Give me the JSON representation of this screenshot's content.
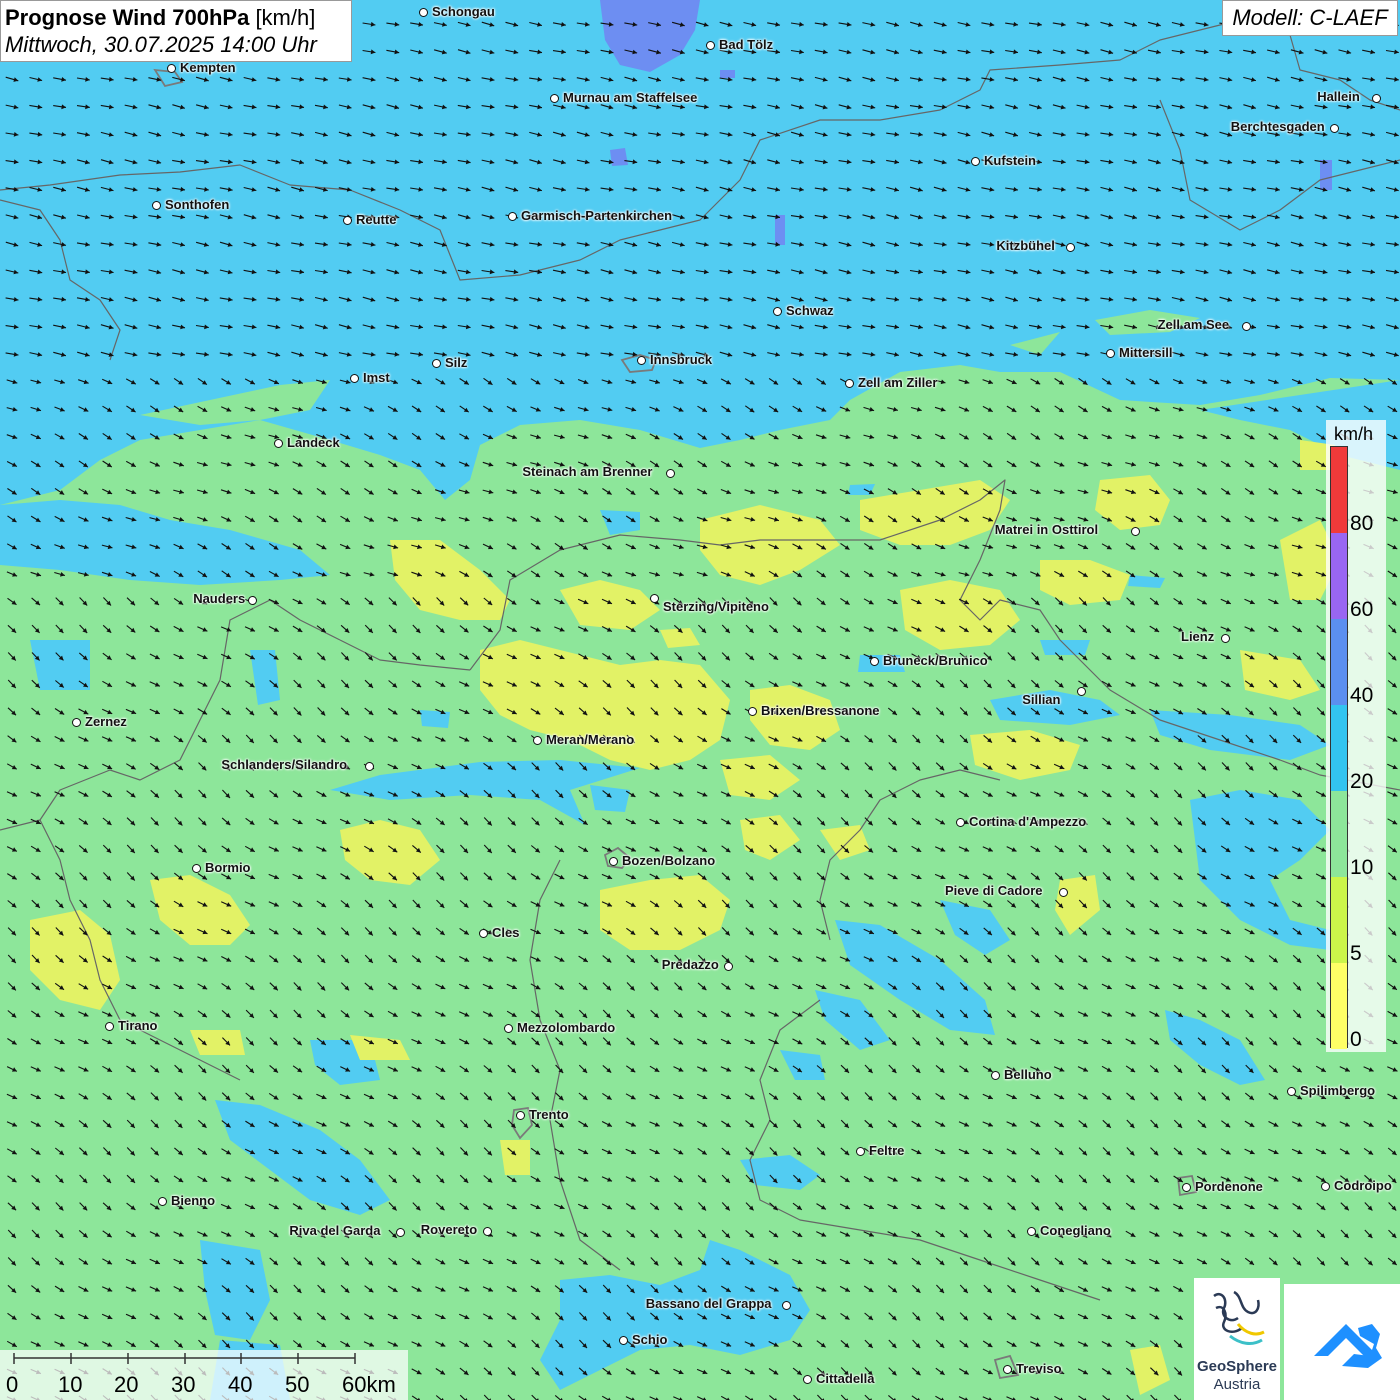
{
  "header": {
    "title_bold": "Prognose Wind 700hPa",
    "title_unit": "[km/h]",
    "datetime": "Mittwoch, 30.07.2025 14:00 Uhr",
    "model": "Modell: C-LAEF"
  },
  "legend": {
    "unit": "km/h",
    "segments": [
      {
        "from": 0,
        "to": 5,
        "color": "#ffff66"
      },
      {
        "from": 5,
        "to": 10,
        "color": "#ccf54a"
      },
      {
        "from": 10,
        "to": 20,
        "color": "#8de69a"
      },
      {
        "from": 20,
        "to": 40,
        "color": "#33c4f0"
      },
      {
        "from": 40,
        "to": 60,
        "color": "#5b8ff0"
      },
      {
        "from": 60,
        "to": 80,
        "color": "#9966f2"
      },
      {
        "from": 80,
        "to": 100,
        "color": "#f03a3a"
      }
    ],
    "labels": [
      "0",
      "5",
      "10",
      "20",
      "40",
      "60",
      "80"
    ]
  },
  "scale": {
    "labels": [
      "0",
      "10",
      "20",
      "30",
      "40",
      "50",
      "60km"
    ]
  },
  "logos": {
    "geosphere_name": "GeoSphere",
    "geosphere_country": "Austria",
    "app_icon": "weather-app-icon"
  },
  "colors": {
    "land_green": "#8de69a",
    "wind_blue": "#52ccf2",
    "wind_yellow": "#e2f266",
    "lake_blue": "#6d8ef2",
    "arrow": "#111111"
  },
  "cities": [
    {
      "name": "Schongau"
    },
    {
      "name": "Bad Tölz"
    },
    {
      "name": "Kempten"
    },
    {
      "name": "Murnau am Staffelsee"
    },
    {
      "name": "Hallein"
    },
    {
      "name": "Berchtesgaden"
    },
    {
      "name": "Kufstein"
    },
    {
      "name": "Sonthofen"
    },
    {
      "name": "Reutte"
    },
    {
      "name": "Garmisch-Partenkirchen"
    },
    {
      "name": "Kitzbühel"
    },
    {
      "name": "Schwaz"
    },
    {
      "name": "Zell am See"
    },
    {
      "name": "Mittersill"
    },
    {
      "name": "Innsbruck"
    },
    {
      "name": "Silz"
    },
    {
      "name": "Imst"
    },
    {
      "name": "Zell am Ziller"
    },
    {
      "name": "Landeck"
    },
    {
      "name": "Steinach am Brenner"
    },
    {
      "name": "Matrei in Osttirol"
    },
    {
      "name": "Nauders"
    },
    {
      "name": "Sterzing/Vipiteno"
    },
    {
      "name": "Lienz"
    },
    {
      "name": "Bruneck/Brunico"
    },
    {
      "name": "Sillian"
    },
    {
      "name": "Brixen/Bressanone"
    },
    {
      "name": "Zernez"
    },
    {
      "name": "Meran/Merano"
    },
    {
      "name": "Schlanders/Silandro"
    },
    {
      "name": "Cortina d'Ampezzo"
    },
    {
      "name": "Bozen/Bolzano"
    },
    {
      "name": "Bormio"
    },
    {
      "name": "Pieve di Cadore"
    },
    {
      "name": "Cles"
    },
    {
      "name": "Predazzo"
    },
    {
      "name": "Tirano"
    },
    {
      "name": "Mezzolombardo"
    },
    {
      "name": "Belluno"
    },
    {
      "name": "Spilimbergo"
    },
    {
      "name": "Trento"
    },
    {
      "name": "Feltre"
    },
    {
      "name": "Bienno"
    },
    {
      "name": "Pordenone"
    },
    {
      "name": "Codroipo"
    },
    {
      "name": "Riva del Garda"
    },
    {
      "name": "Rovereto"
    },
    {
      "name": "Conegliano"
    },
    {
      "name": "Bassano del Grappa"
    },
    {
      "name": "Schio"
    },
    {
      "name": "Treviso"
    },
    {
      "name": "Cittadella"
    }
  ]
}
